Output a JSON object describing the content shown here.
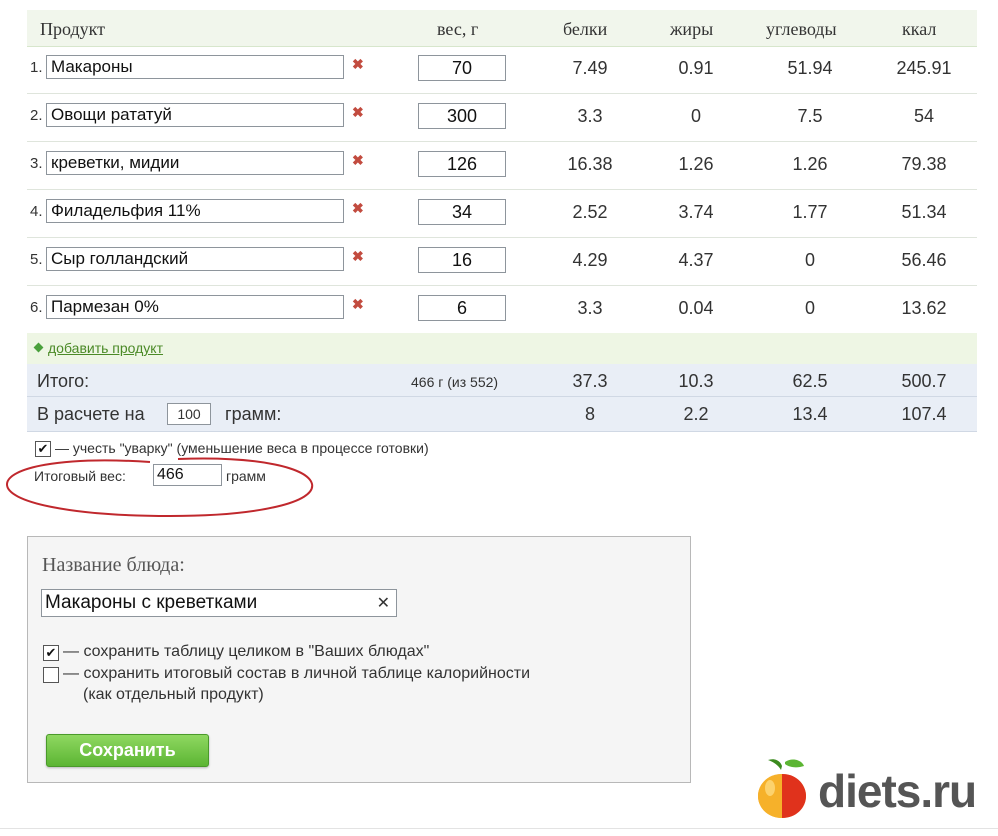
{
  "table": {
    "headers": {
      "product": "Продукт",
      "weight": "вес, г",
      "protein": "белки",
      "fat": "жиры",
      "carbs": "углеводы",
      "kcal": "ккал"
    },
    "rows": [
      {
        "num": "1.",
        "name": "Макароны",
        "weight": "70",
        "protein": "7.49",
        "fat": "0.91",
        "carbs": "51.94",
        "kcal": "245.91"
      },
      {
        "num": "2.",
        "name": "Овощи рататуй",
        "weight": "300",
        "protein": "3.3",
        "fat": "0",
        "carbs": "7.5",
        "kcal": "54"
      },
      {
        "num": "3.",
        "name": "креветки, мидии",
        "weight": "126",
        "protein": "16.38",
        "fat": "1.26",
        "carbs": "1.26",
        "kcal": "79.38"
      },
      {
        "num": "4.",
        "name": "Филадельфия 11%",
        "weight": "34",
        "protein": "2.52",
        "fat": "3.74",
        "carbs": "1.77",
        "kcal": "51.34"
      },
      {
        "num": "5.",
        "name": "Сыр голландский",
        "weight": "16",
        "protein": "4.29",
        "fat": "4.37",
        "carbs": "0",
        "kcal": "56.46"
      },
      {
        "num": "6.",
        "name": "Пармезан 0%",
        "weight": "6",
        "protein": "3.3",
        "fat": "0.04",
        "carbs": "0",
        "kcal": "13.62"
      }
    ],
    "delete_glyph": "✖",
    "add_product": "добавить продукт",
    "total": {
      "label": "Итого:",
      "weight": "466 г (из 552)",
      "protein": "37.3",
      "fat": "10.3",
      "carbs": "62.5",
      "kcal": "500.7"
    },
    "per": {
      "label_before": "В расчете на",
      "value": "100",
      "label_after": "грамм:",
      "protein": "8",
      "fat": "2.2",
      "carbs": "13.4",
      "kcal": "107.4"
    }
  },
  "boil": {
    "checked": "✔",
    "label": "— учесть \"уварку\" (уменьшение веса в процессе готовки)"
  },
  "final_weight": {
    "label": "Итоговый вес:",
    "value": "466",
    "unit": "грамм"
  },
  "dish": {
    "title": "Название блюда:",
    "name_value": "Макароны с креветками",
    "clear_glyph": "✕",
    "opt1": {
      "checked": "✔",
      "label": "— сохранить таблицу целиком в \"Ваших блюдах\""
    },
    "opt2": {
      "checked": "",
      "label": "— сохранить итоговый состав в личной таблице калорийности",
      "label2": "(как отдельный продукт)"
    },
    "save_button": "Сохранить"
  },
  "logo": {
    "text": "diets.ru"
  },
  "colors": {
    "accent_green": "#5cb533",
    "annotation_red": "#c0282d",
    "total_bg": "#e9eef6",
    "header_bg": "#f1f6ec"
  }
}
